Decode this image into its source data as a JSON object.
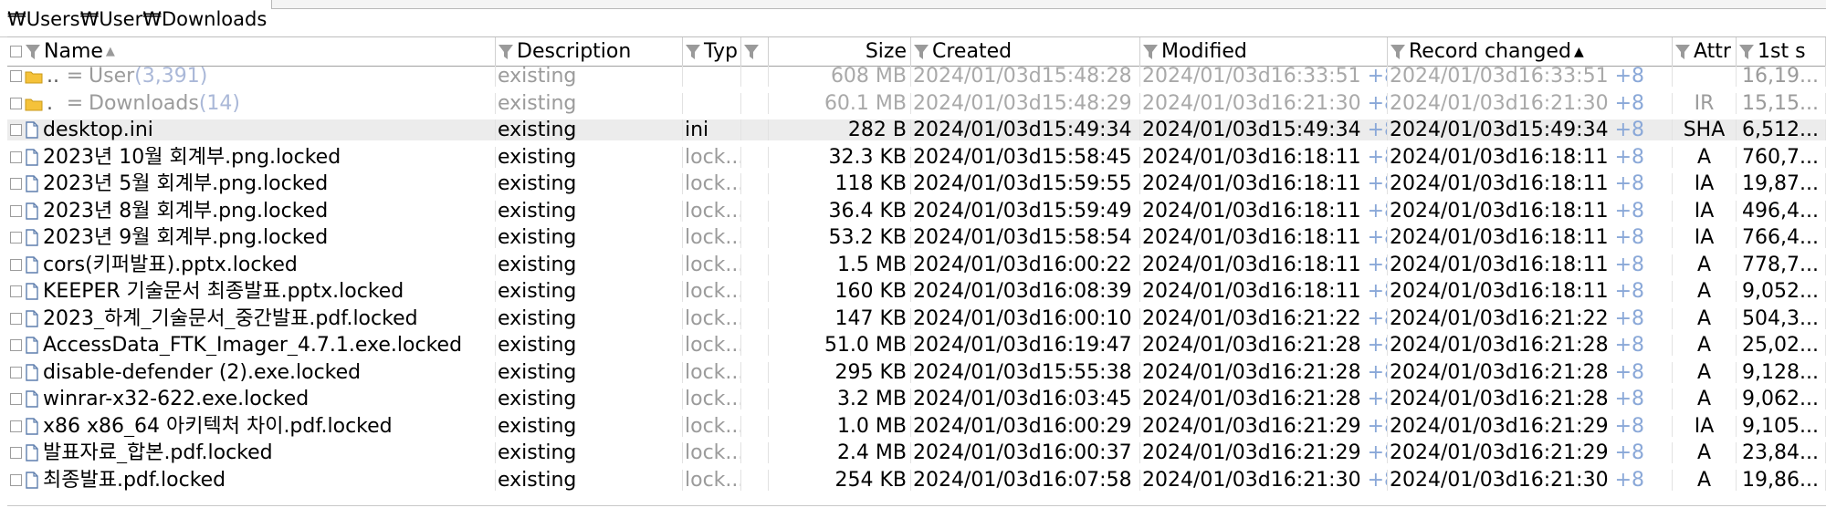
{
  "window": {
    "path": "₩Users₩User₩Downloads"
  },
  "columns": [
    {
      "label": "Name",
      "sort": "▲"
    },
    {
      "label": "Description"
    },
    {
      "label": "Typ"
    },
    {
      "label": ""
    },
    {
      "label": "Size"
    },
    {
      "label": "Created"
    },
    {
      "label": "Modified"
    },
    {
      "label": "Record changed",
      "sort": "▲"
    },
    {
      "label": "Attr"
    },
    {
      "label": "1st s"
    }
  ],
  "parent_rows": [
    {
      "dots": "..",
      "eq": "=",
      "name": "User",
      "count": "(3,391)",
      "description": "existing",
      "size": "608 MB",
      "created": "2024/01/03d15:48:28",
      "modified": "2024/01/03d16:33:51",
      "tz": "+8",
      "changed": "2024/01/03d16:33:51",
      "changed_tz": "+8",
      "attr": "",
      "first": "16,19..."
    },
    {
      "dots": ".",
      "eq": "=",
      "name": "Downloads",
      "count": "(14)",
      "description": "existing",
      "size": "60.1 MB",
      "created": "2024/01/03d15:48:29",
      "modified": "2024/01/03d16:21:30",
      "tz": "+8",
      "changed": "2024/01/03d16:21:30",
      "changed_tz": "+8",
      "attr": "IR",
      "first": "15,15..."
    }
  ],
  "files": [
    {
      "name": "desktop.ini",
      "description": "existing",
      "type": "ini",
      "size": "282 B",
      "created": "2024/01/03d15:49:34",
      "modified": "2024/01/03d15:49:34",
      "tz": "+8",
      "changed": "2024/01/03d15:49:34",
      "changed_tz": "+8",
      "attr": "SHA",
      "first": "6,512...",
      "selected": true
    },
    {
      "name": "2023년 10월 회계부.png.locked",
      "description": "existing",
      "type": "lock...",
      "size": "32.3 KB",
      "created": "2024/01/03d15:58:45",
      "modified": "2024/01/03d16:18:11",
      "tz": "+8",
      "changed": "2024/01/03d16:18:11",
      "changed_tz": "+8",
      "attr": "A",
      "first": "760,7..."
    },
    {
      "name": "2023년 5월 회계부.png.locked",
      "description": "existing",
      "type": "lock...",
      "size": "118 KB",
      "created": "2024/01/03d15:59:55",
      "modified": "2024/01/03d16:18:11",
      "tz": "+8",
      "changed": "2024/01/03d16:18:11",
      "changed_tz": "+8",
      "attr": "IA",
      "first": "19,87..."
    },
    {
      "name": "2023년 8월 회계부.png.locked",
      "description": "existing",
      "type": "lock...",
      "size": "36.4 KB",
      "created": "2024/01/03d15:59:49",
      "modified": "2024/01/03d16:18:11",
      "tz": "+8",
      "changed": "2024/01/03d16:18:11",
      "changed_tz": "+8",
      "attr": "IA",
      "first": "496,4..."
    },
    {
      "name": "2023년 9월 회계부.png.locked",
      "description": "existing",
      "type": "lock...",
      "size": "53.2 KB",
      "created": "2024/01/03d15:58:54",
      "modified": "2024/01/03d16:18:11",
      "tz": "+8",
      "changed": "2024/01/03d16:18:11",
      "changed_tz": "+8",
      "attr": "IA",
      "first": "766,4..."
    },
    {
      "name": "cors(키퍼발표).pptx.locked",
      "description": "existing",
      "type": "lock...",
      "size": "1.5 MB",
      "created": "2024/01/03d16:00:22",
      "modified": "2024/01/03d16:18:11",
      "tz": "+8",
      "changed": "2024/01/03d16:18:11",
      "changed_tz": "+8",
      "attr": "A",
      "first": "778,7..."
    },
    {
      "name": "KEEPER 기술문서 최종발표.pptx.locked",
      "description": "existing",
      "type": "lock...",
      "size": "160 KB",
      "created": "2024/01/03d16:08:39",
      "modified": "2024/01/03d16:18:11",
      "tz": "+8",
      "changed": "2024/01/03d16:18:11",
      "changed_tz": "+8",
      "attr": "A",
      "first": "9,052..."
    },
    {
      "name": "2023_하계_기술문서_중간발표.pdf.locked",
      "description": "existing",
      "type": "lock...",
      "size": "147 KB",
      "created": "2024/01/03d16:00:10",
      "modified": "2024/01/03d16:21:22",
      "tz": "+8",
      "changed": "2024/01/03d16:21:22",
      "changed_tz": "+8",
      "attr": "A",
      "first": "504,3..."
    },
    {
      "name": "AccessData_FTK_Imager_4.7.1.exe.locked",
      "description": "existing",
      "type": "lock...",
      "size": "51.0 MB",
      "created": "2024/01/03d16:19:47",
      "modified": "2024/01/03d16:21:28",
      "tz": "+8",
      "changed": "2024/01/03d16:21:28",
      "changed_tz": "+8",
      "attr": "A",
      "first": "25,02..."
    },
    {
      "name": "disable-defender (2).exe.locked",
      "description": "existing",
      "type": "lock...",
      "size": "295 KB",
      "created": "2024/01/03d15:55:38",
      "modified": "2024/01/03d16:21:28",
      "tz": "+8",
      "changed": "2024/01/03d16:21:28",
      "changed_tz": "+8",
      "attr": "A",
      "first": "9,128..."
    },
    {
      "name": "winrar-x32-622.exe.locked",
      "description": "existing",
      "type": "lock...",
      "size": "3.2 MB",
      "created": "2024/01/03d16:03:45",
      "modified": "2024/01/03d16:21:28",
      "tz": "+8",
      "changed": "2024/01/03d16:21:28",
      "changed_tz": "+8",
      "attr": "A",
      "first": "9,062..."
    },
    {
      "name": "x86 x86_64 아키텍처 차이.pdf.locked",
      "description": "existing",
      "type": "lock...",
      "size": "1.0 MB",
      "created": "2024/01/03d16:00:29",
      "modified": "2024/01/03d16:21:29",
      "tz": "+8",
      "changed": "2024/01/03d16:21:29",
      "changed_tz": "+8",
      "attr": "IA",
      "first": "9,105..."
    },
    {
      "name": "발표자료_합본.pdf.locked",
      "description": "existing",
      "type": "lock...",
      "size": "2.4 MB",
      "created": "2024/01/03d16:00:37",
      "modified": "2024/01/03d16:21:29",
      "tz": "+8",
      "changed": "2024/01/03d16:21:29",
      "changed_tz": "+8",
      "attr": "A",
      "first": "23,84..."
    },
    {
      "name": "최종발표.pdf.locked",
      "description": "existing",
      "type": "lock...",
      "size": "254 KB",
      "created": "2024/01/03d16:07:58",
      "modified": "2024/01/03d16:21:30",
      "tz": "+8",
      "changed": "2024/01/03d16:21:30",
      "changed_tz": "+8",
      "attr": "A",
      "first": "19,86..."
    }
  ]
}
